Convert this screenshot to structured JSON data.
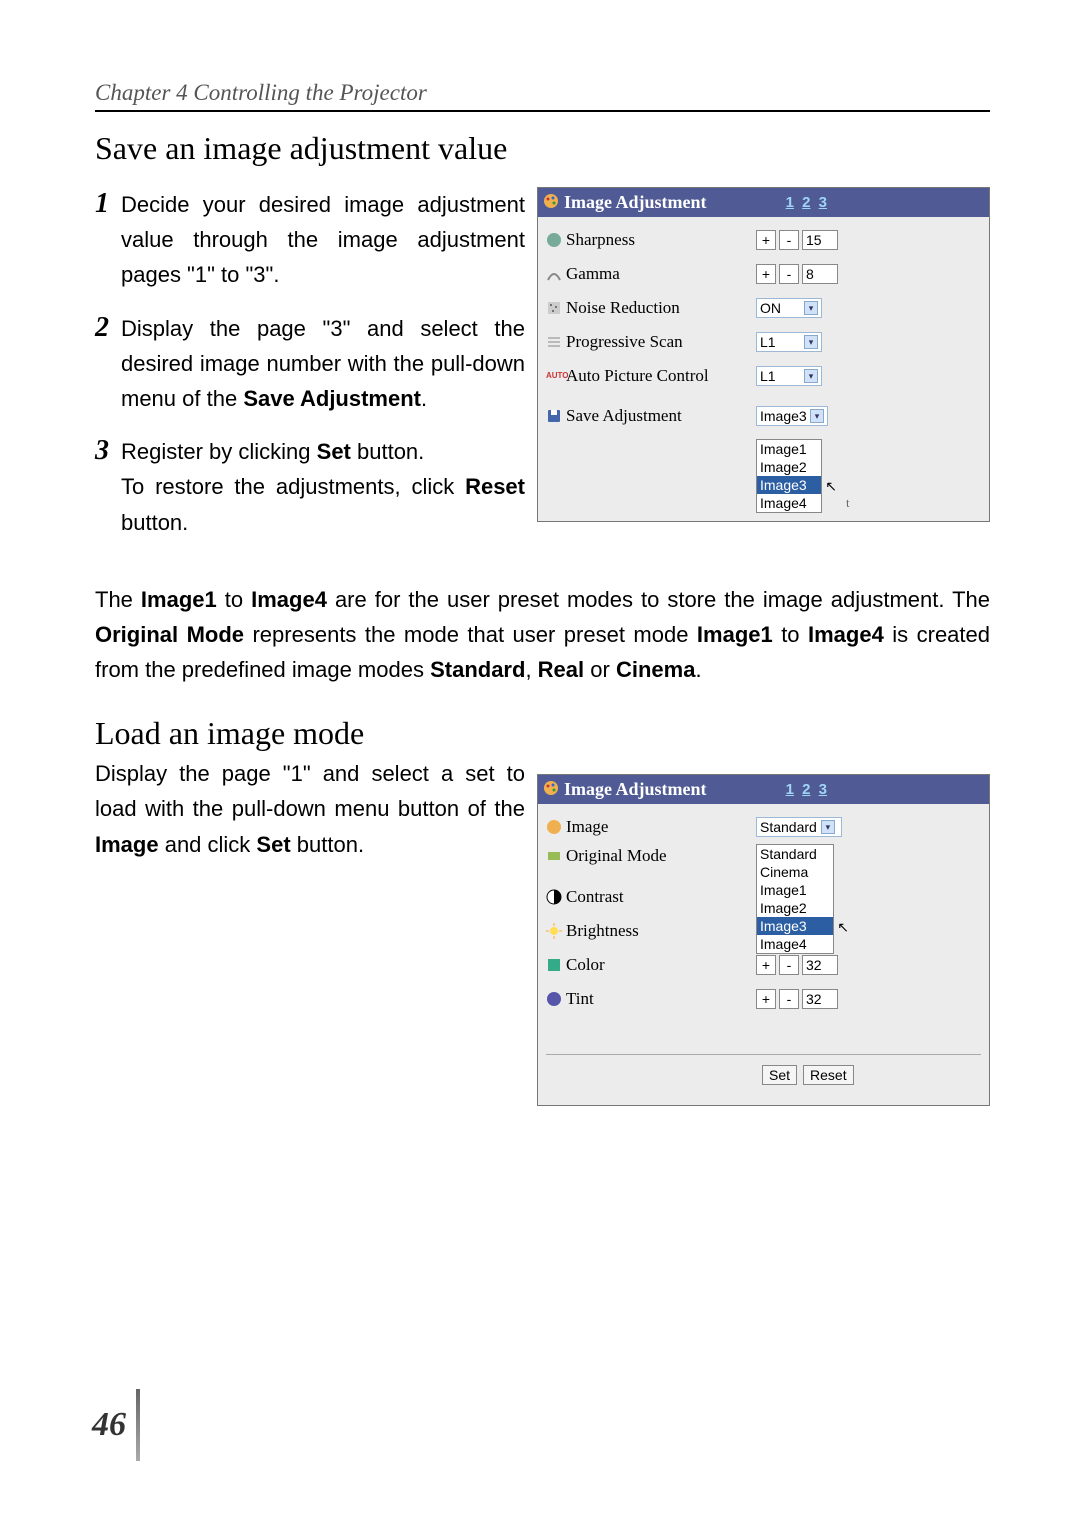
{
  "chapter_header": "Chapter 4 Controlling the Projector",
  "section1_title": "Save an image adjustment value",
  "steps": {
    "s1_p1": "Decide your desired image adjustment value through the image adjustment pages \"1\" to \"3\".",
    "s2_p1": "Display the page \"3\" and select the desired image number with the pull-down menu of the ",
    "s2_bold": "Save Adjustment",
    "s2_p2": ".",
    "s3_p1": "Register by clicking ",
    "s3_bold1": "Set",
    "s3_p2": " button.",
    "s3_p3": "To restore the adjustments, click ",
    "s3_bold2": "Reset",
    "s3_p4": " button."
  },
  "panel1": {
    "title": "Image Adjustment",
    "pages": [
      "1",
      "2",
      "3"
    ],
    "sharpness_label": "Sharpness",
    "sharpness_val": "15",
    "gamma_label": "Gamma",
    "gamma_val": "8",
    "noise_label": "Noise Reduction",
    "noise_val": "ON",
    "prog_label": "Progressive Scan",
    "prog_val": "L1",
    "apc_label": "Auto Picture Control",
    "apc_val": "L1",
    "save_label": "Save Adjustment",
    "save_val": "Image3",
    "dd": [
      "Image1",
      "Image2",
      "Image3",
      "Image4"
    ],
    "cutoff": "t"
  },
  "middle_para_p1": "The ",
  "middle_para_b1": "Image1",
  "middle_para_p2": " to ",
  "middle_para_b2": "Image4",
  "middle_para_p3": " are for the user preset modes to store the image adjustment. The ",
  "middle_para_b3": "Original Mode",
  "middle_para_p4": " represents the mode that user preset mode ",
  "middle_para_b4": "Image1",
  "middle_para_p5": " to ",
  "middle_para_b5": "Image4",
  "middle_para_p6": " is created from the predefined image modes ",
  "middle_para_b6": "Standard",
  "middle_para_p7": ", ",
  "middle_para_b7": "Real",
  "middle_para_p8": " or ",
  "middle_para_b8": "Cinema",
  "middle_para_p9": ".",
  "section2_title": "Load an image mode",
  "desc2_p1": "Display the page \"1\" and select a set to load with the pull-down menu button of the ",
  "desc2_b1": "Image",
  "desc2_p2": " and click ",
  "desc2_b2": "Set",
  "desc2_p3": " button.",
  "panel2": {
    "title": "Image Adjustment",
    "pages": [
      "1",
      "2",
      "3"
    ],
    "image_label": "Image",
    "image_val": "Standard",
    "orig_label": "Original Mode",
    "contrast_label": "Contrast",
    "brightness_label": "Brightness",
    "color_label": "Color",
    "color_val": "32",
    "tint_label": "Tint",
    "tint_val": "32",
    "dd": [
      "Standard",
      "Cinema",
      "Image1",
      "Image2",
      "Image3",
      "Image4"
    ],
    "set_btn": "Set",
    "reset_btn": "Reset"
  },
  "icons": {
    "plus": "+",
    "minus": "-",
    "arrow_down": "▾"
  },
  "page_number": "46"
}
